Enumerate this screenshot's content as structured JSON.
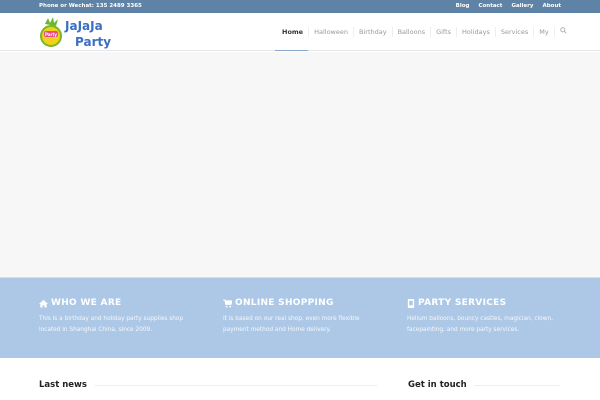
{
  "topbar": {
    "phone": "Phone or Wechat: 135 2489 3365",
    "links": [
      "Blog",
      "Contact",
      "Gallery",
      "About"
    ]
  },
  "logo": {
    "text_line1": "JaJaJa",
    "text_line2": "Party",
    "badge": "Party"
  },
  "nav": {
    "items": [
      "Home",
      "Halloween",
      "Birthday",
      "Balloons",
      "Gifts",
      "Holidays",
      "Services",
      "My"
    ],
    "active": "Home",
    "search_icon": "search-icon"
  },
  "features": [
    {
      "icon": "home-icon",
      "title": "WHO WE ARE",
      "text": "This is a birthday and holiday party supplies shop located in Shanghai China, since 2009."
    },
    {
      "icon": "cart-icon",
      "title": "ONLINE SHOPPING",
      "text": "It is based on our real shop,  even more flexible payment method and Home delivery."
    },
    {
      "icon": "phone-icon",
      "title": "PARTY SERVICES",
      "text": "Helium balloons, bouncy castles, magician, clown, facepainting, and more party services."
    }
  ],
  "footer": {
    "last_news": "Last news",
    "get_in_touch": "Get in touch"
  },
  "colors": {
    "topbar": "#5f83a6",
    "band": "#adc8e6"
  }
}
